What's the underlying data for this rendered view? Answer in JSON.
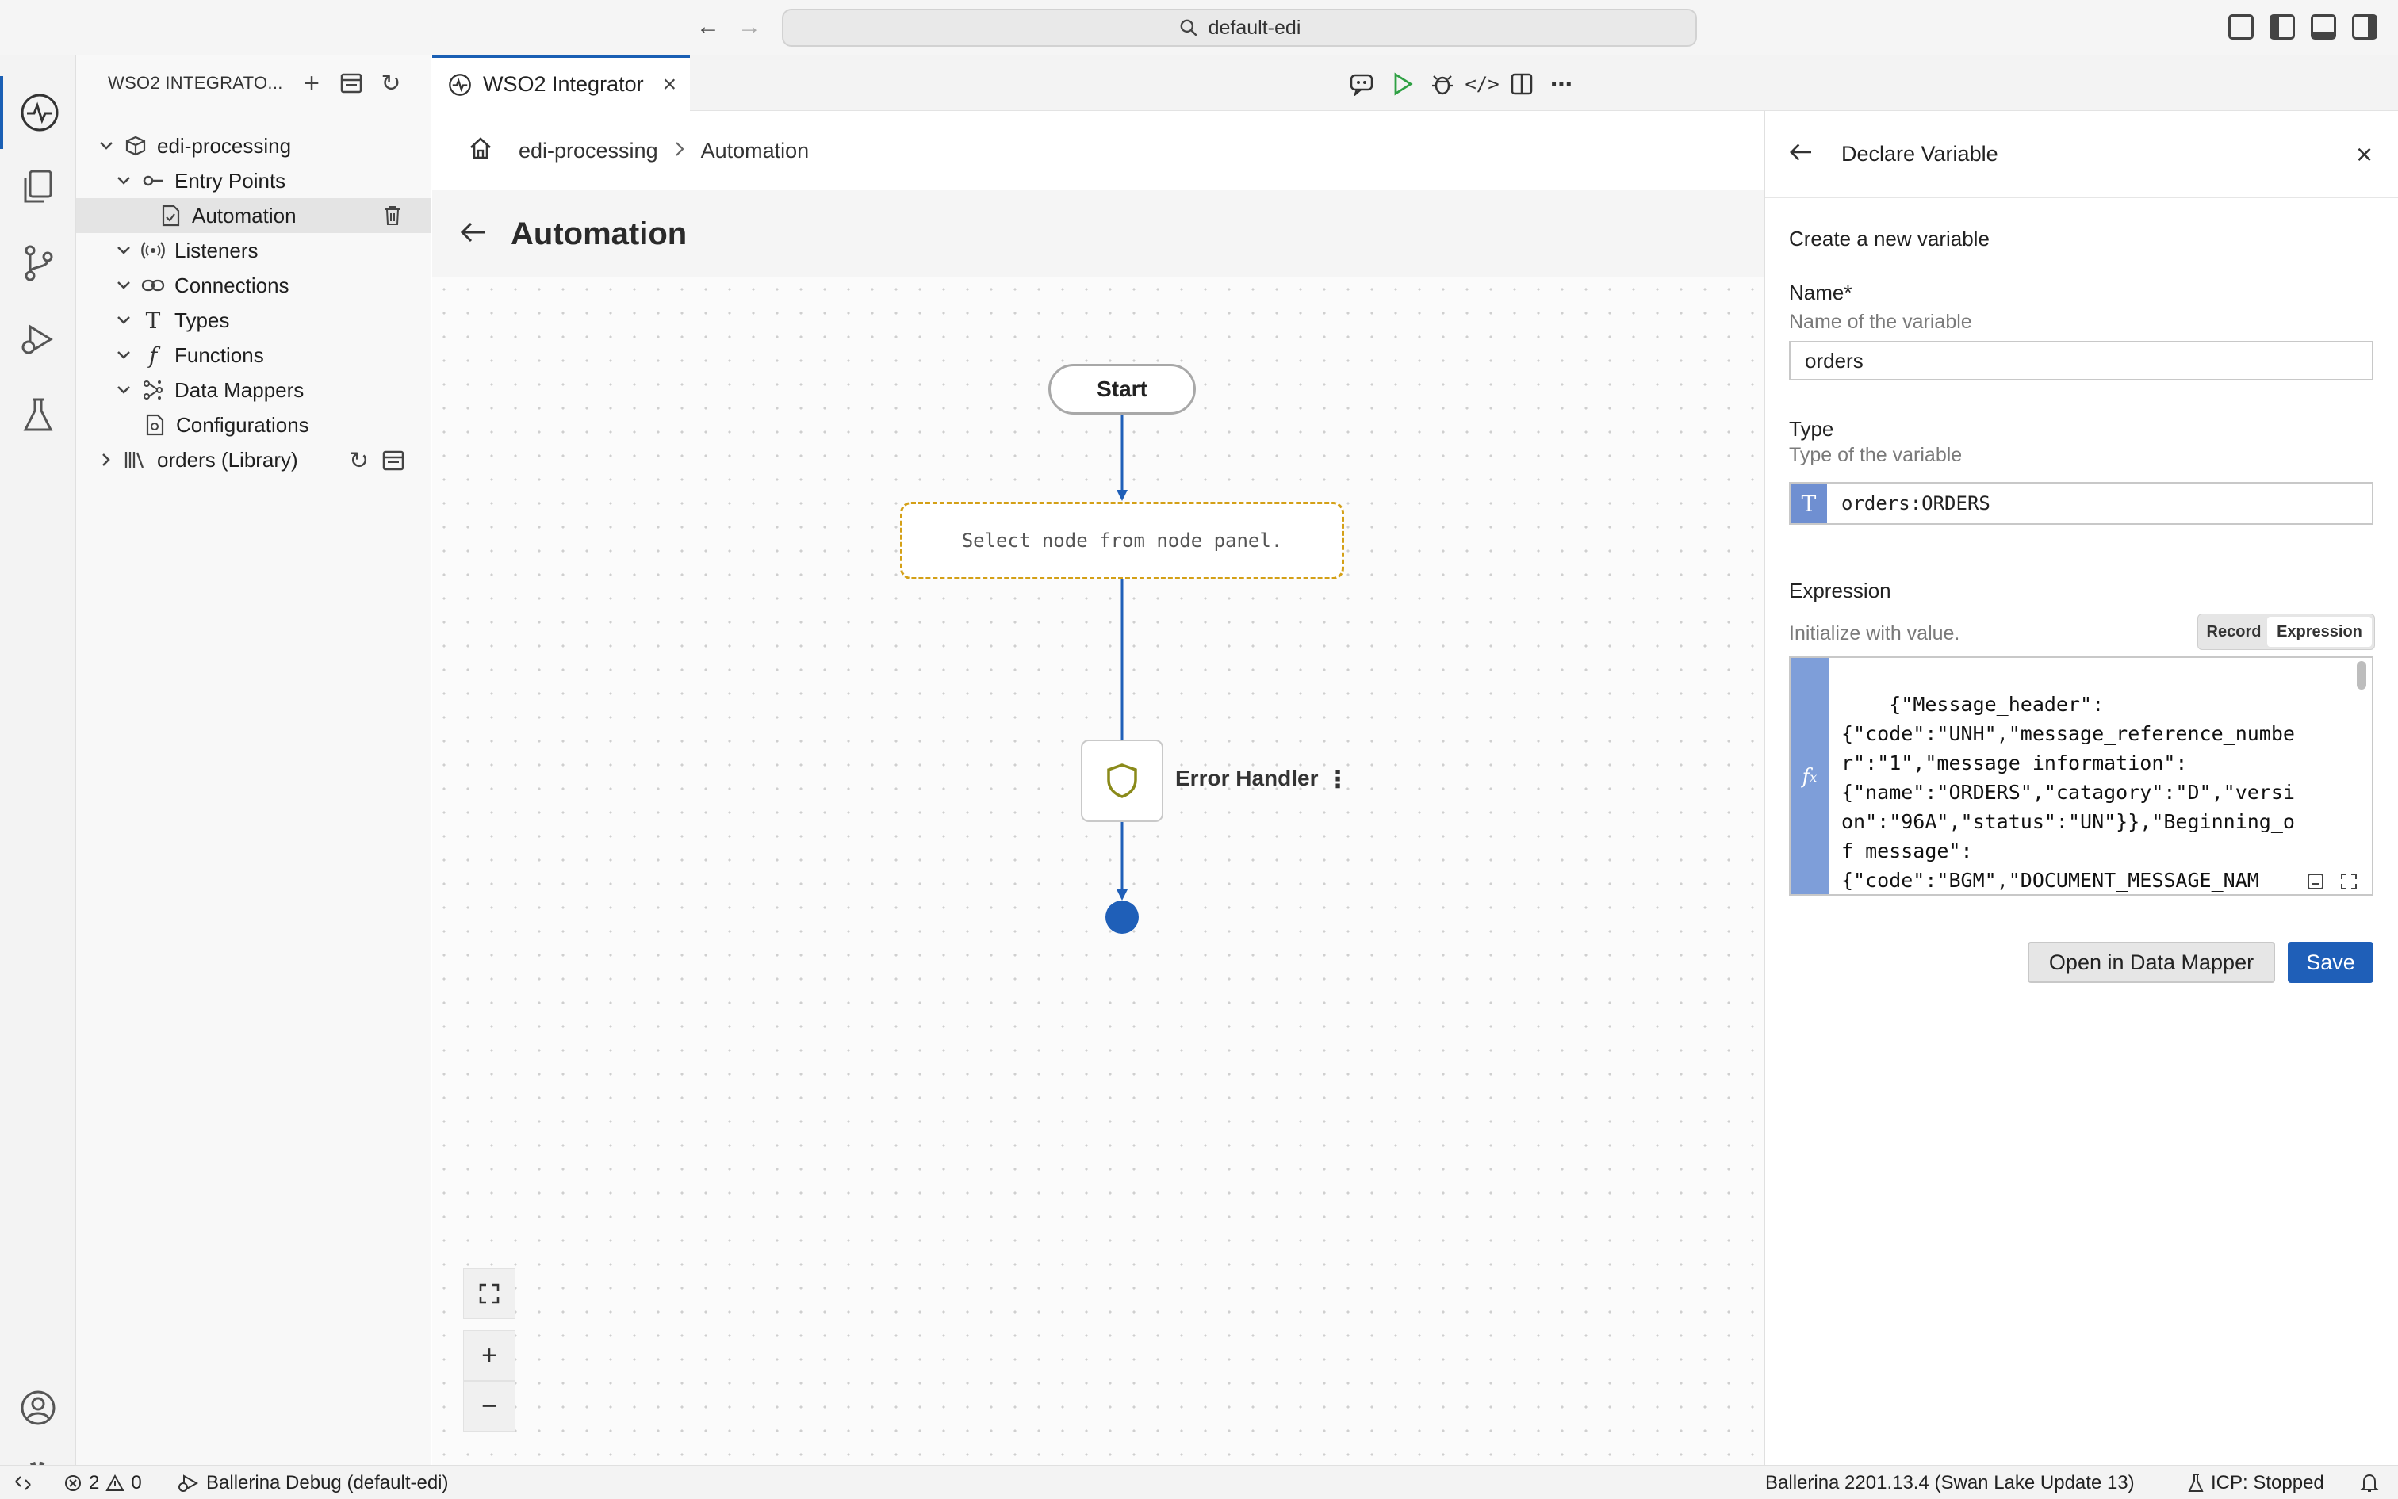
{
  "window": {
    "command_center": "default-edi"
  },
  "explorer": {
    "title": "WSO2 INTEGRATO...",
    "project": "edi-processing",
    "items": [
      {
        "label": "Entry Points"
      },
      {
        "label": "Automation"
      },
      {
        "label": "Listeners"
      },
      {
        "label": "Connections"
      },
      {
        "label": "Types"
      },
      {
        "label": "Functions"
      },
      {
        "label": "Data Mappers"
      },
      {
        "label": "Configurations"
      },
      {
        "label": "orders (Library)"
      }
    ]
  },
  "editor": {
    "tab_label": "WSO2 Integrator",
    "breadcrumb": [
      "edi-processing",
      "Automation"
    ],
    "page_title": "Automation"
  },
  "flow": {
    "start_label": "Start",
    "placeholder_text": "Select node from node panel.",
    "error_handler_label": "Error Handler"
  },
  "panel": {
    "title": "Declare Variable",
    "subtitle": "Create a new variable",
    "name_label": "Name*",
    "name_help": "Name of the variable",
    "name_value": "orders",
    "type_label": "Type",
    "type_help": "Type of the variable",
    "type_value": "orders:ORDERS",
    "expression_label": "Expression",
    "expression_help": "Initialize with value.",
    "mode_record": "Record",
    "mode_expression": "Expression",
    "expression_value": "    {\"Message_header\":\n{\"code\":\"UNH\",\"message_reference_number\":\"1\",\"message_information\":\n{\"name\":\"ORDERS\",\"catagory\":\"D\",\"version\":\"96A\",\"status\":\"UN\"}},\"Beginning_of_message\":\n{\"code\":\"BGM\",\"DOCUMENT_MESSAGE_NAM",
    "open_mapper_label": "Open in Data Mapper",
    "save_label": "Save"
  },
  "status": {
    "errors": "2",
    "warnings": "0",
    "debug": "Ballerina Debug (default-edi)",
    "version": "Ballerina 2201.13.4 (Swan Lake Update 13)",
    "icp": "ICP: Stopped"
  },
  "colors": {
    "accent": "#1f5fb8",
    "placeholder_border": "#d4a017",
    "type_badge": "#6f8fd1"
  }
}
